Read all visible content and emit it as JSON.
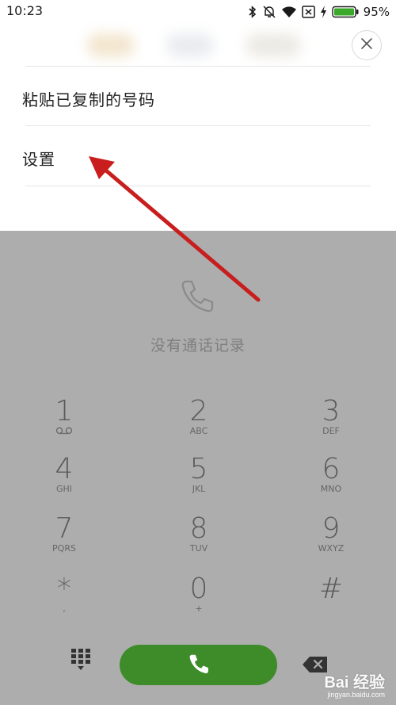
{
  "status_bar": {
    "time": "10:23",
    "battery_percent": "95%",
    "icons": [
      "bluetooth-icon",
      "mute-bell-icon",
      "wifi-icon",
      "no-sim-icon",
      "charging-icon",
      "battery-icon"
    ]
  },
  "menu": {
    "items": [
      {
        "label": "粘贴已复制的号码"
      },
      {
        "label": "设置"
      }
    ],
    "close_icon": "close-icon"
  },
  "dialer": {
    "empty_message": "没有通话记录",
    "keys": [
      {
        "digit": "1",
        "letters": ""
      },
      {
        "digit": "2",
        "letters": "ABC"
      },
      {
        "digit": "3",
        "letters": "DEF"
      },
      {
        "digit": "4",
        "letters": "GHI"
      },
      {
        "digit": "5",
        "letters": "JKL"
      },
      {
        "digit": "6",
        "letters": "MNO"
      },
      {
        "digit": "7",
        "letters": "PQRS"
      },
      {
        "digit": "8",
        "letters": "TUV"
      },
      {
        "digit": "9",
        "letters": "WXYZ"
      },
      {
        "digit": "*",
        "letters": ","
      },
      {
        "digit": "0",
        "letters": "+"
      },
      {
        "digit": "#",
        "letters": ""
      }
    ],
    "call_button_color": "#3d8c29"
  },
  "watermark": {
    "main": "Bai 经验",
    "sub": "jingyan.baidu.com"
  },
  "colors": {
    "dim_overlay": "#adadad",
    "annotation_arrow": "#c81e1e"
  }
}
